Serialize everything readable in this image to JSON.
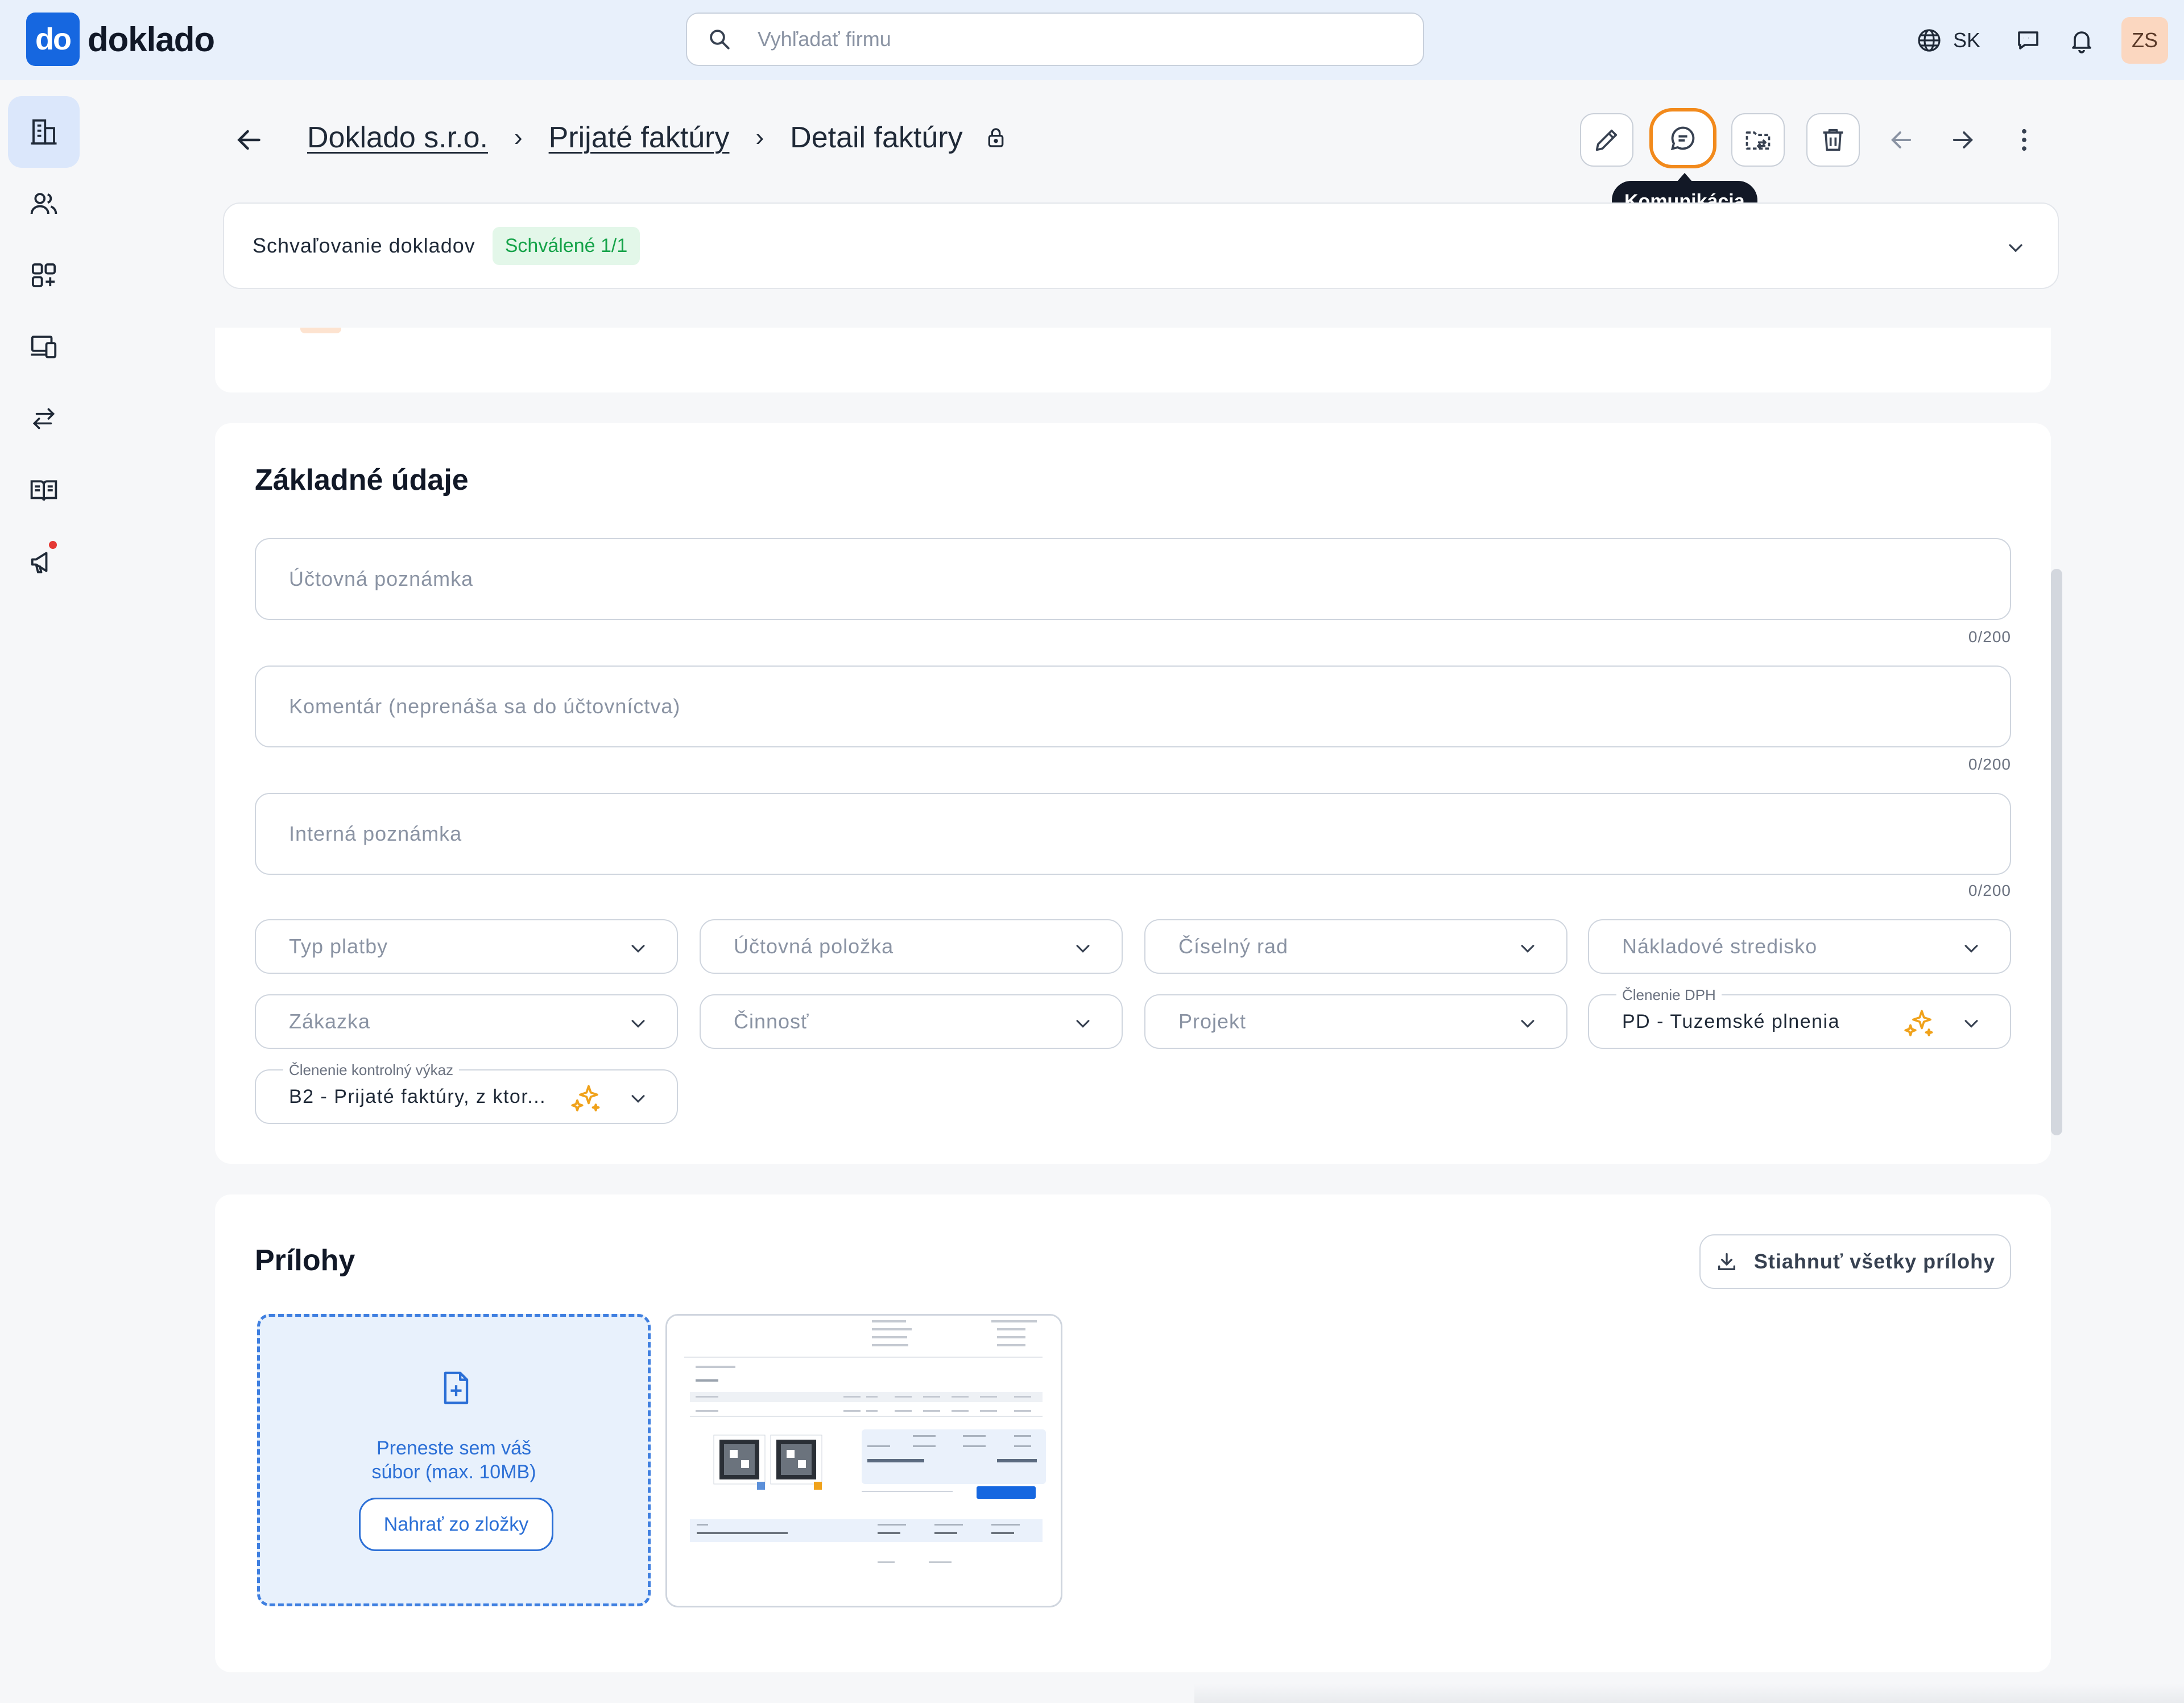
{
  "brand": {
    "logo_mark": "do",
    "name": "doklado",
    "accent_color": "#1667e0"
  },
  "search": {
    "placeholder": "Vyhľadať firmu"
  },
  "topbar": {
    "language": "SK",
    "avatar_initials": "ZS"
  },
  "sidebar": {
    "items": [
      {
        "icon": "company-icon",
        "active": true
      },
      {
        "icon": "users-icon"
      },
      {
        "icon": "apps-icon"
      },
      {
        "icon": "devices-icon"
      },
      {
        "icon": "transfer-icon"
      },
      {
        "icon": "book-icon"
      },
      {
        "icon": "megaphone-icon",
        "has_notification": true
      }
    ]
  },
  "breadcrumb": {
    "items": [
      "Doklado s.r.o.",
      "Prijaté faktúry"
    ],
    "current": "Detail faktúry"
  },
  "toolbar": {
    "tooltip": "Komunikácia",
    "highlight_color": "#f28a1c"
  },
  "approval": {
    "label": "Schvaľovanie dokladov",
    "badge": "Schválené 1/1"
  },
  "basic": {
    "title": "Základné údaje",
    "fields": [
      {
        "placeholder": "Účtovná poznámka",
        "counter": "0/200"
      },
      {
        "placeholder": "Komentár (neprenáša sa do účtovníctva)",
        "counter": "0/200"
      },
      {
        "placeholder": "Interná poznámka",
        "counter": "0/200"
      }
    ],
    "selects": {
      "typ_platby": "Typ platby",
      "uctovna_polozka": "Účtovná položka",
      "ciselny_rad": "Číselný rad",
      "nakladove_stredisko": "Nákladové stredisko",
      "zakazka": "Zákazka",
      "cinnost": "Činnosť",
      "projekt": "Projekt",
      "clenenie_dph": {
        "label": "Členenie DPH",
        "value": "PD - Tuzemské plnenia"
      },
      "clenenie_kv": {
        "label": "Členenie kontrolný výkaz",
        "value": "B2 - Prijaté faktúry, z ktor..."
      }
    }
  },
  "attachments": {
    "title": "Prílohy",
    "download_all": "Stiahnuť všetky prílohy",
    "dropzone_line1": "Preneste sem váš",
    "dropzone_line2": "súbor (max. 10MB)",
    "upload_button": "Nahrať zo zložky"
  }
}
